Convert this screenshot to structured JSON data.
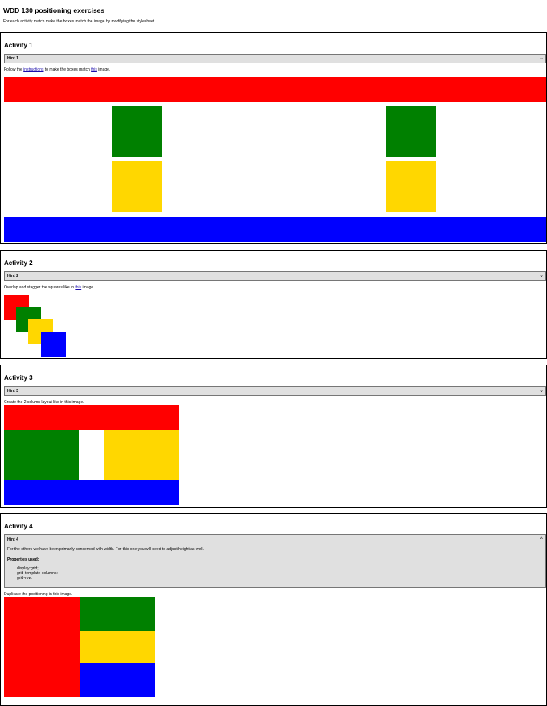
{
  "page": {
    "title": "WDD 130 positioning exercises",
    "subtitle": "For each activity match make the boxes match the image by modifying the stylesheet."
  },
  "activity1": {
    "title": "Activity 1",
    "hint_label": "Hint 1",
    "instr_prefix": "Follow the ",
    "instr_link1": "instructions",
    "instr_middle": " to make the boxes match ",
    "instr_link2": "this",
    "instr_suffix": " image."
  },
  "activity2": {
    "title": "Activity 2",
    "hint_label": "Hint 2",
    "instr_prefix": "Overlap and stagger the squares like in ",
    "instr_link": "this",
    "instr_suffix": " image."
  },
  "activity3": {
    "title": "Activity 3",
    "hint_label": "Hint 3",
    "instr_prefix": "Create the 2 column layout like in ",
    "instr_link": "this",
    "instr_suffix": " image."
  },
  "activity4": {
    "title": "Activity 4",
    "hint_label": "Hint 4",
    "hint_text": "For the others we have been primarily concerned with width. For this one you will need to adjust height as well.",
    "props_title": "Properties used:",
    "props": [
      "display:grid;",
      "grid-template-columns:",
      "grid-row:"
    ],
    "instr_prefix": "Duplicate the positioning in ",
    "instr_link": "this",
    "instr_suffix": " image."
  },
  "icons": {
    "chevron_down": "chevron-down-icon",
    "chevron_up": "chevron-up-icon"
  },
  "colors": {
    "red": "#ff0000",
    "green": "#008000",
    "gold": "#ffd700",
    "blue": "#0000ff",
    "hint_bg": "#e0e0e0"
  }
}
